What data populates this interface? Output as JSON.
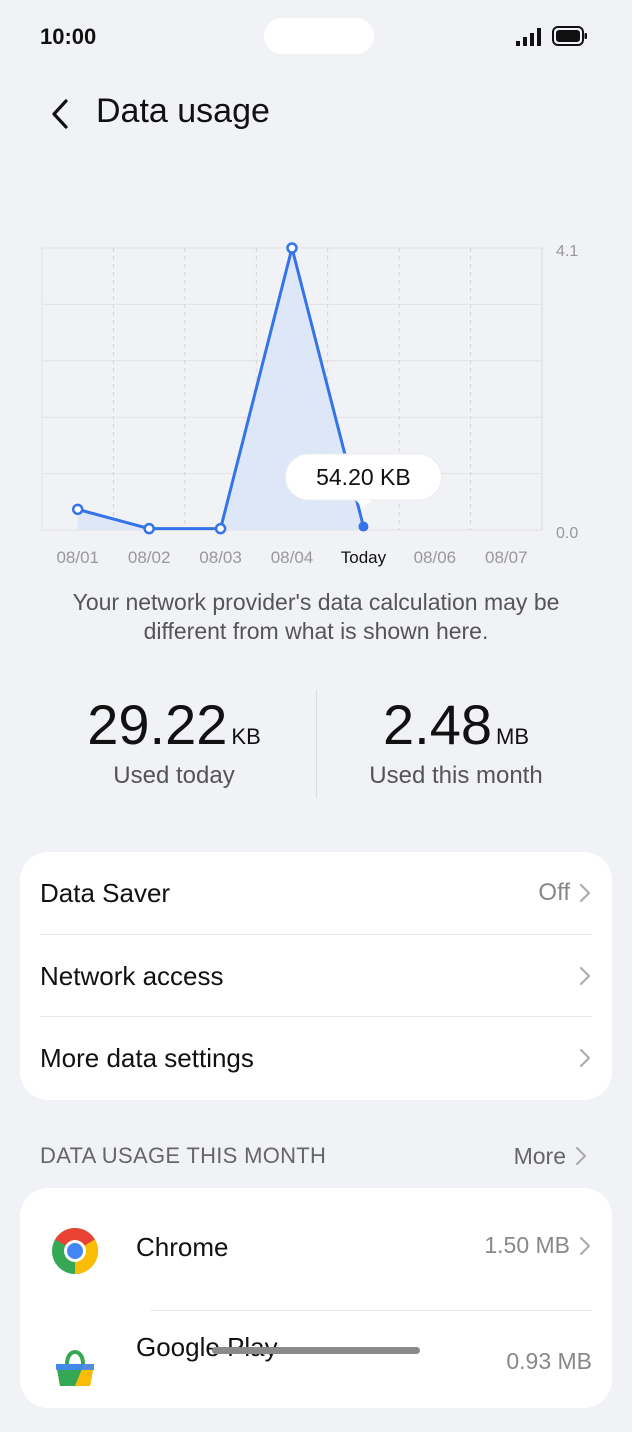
{
  "status_bar": {
    "time": "10:00"
  },
  "header": {
    "title": "Data usage"
  },
  "chart_data": {
    "type": "area",
    "categories": [
      "08/01",
      "08/02",
      "08/03",
      "08/04",
      "Today",
      "08/06",
      "08/07"
    ],
    "values": [
      0.3,
      0.02,
      0.02,
      4.1,
      0.05
    ],
    "ylim": [
      0.0,
      4.1
    ],
    "y_ticks": [
      "4.1",
      "0.0"
    ],
    "highlight_index": 4,
    "tooltip": "54.20 KB",
    "line_color": "#3574e8",
    "fill_color": "#dbe5f8"
  },
  "disclaimer": "Your network provider's data calculation may be different from what is shown here.",
  "stats": {
    "today": {
      "value": "29.22",
      "unit": "KB",
      "label": "Used today"
    },
    "month": {
      "value": "2.48",
      "unit": "MB",
      "label": "Used this month"
    }
  },
  "settings": [
    {
      "label": "Data Saver",
      "value": "Off"
    },
    {
      "label": "Network access",
      "value": ""
    },
    {
      "label": "More data settings",
      "value": ""
    }
  ],
  "section": {
    "title": "DATA USAGE THIS MONTH",
    "more_label": "More"
  },
  "apps": [
    {
      "name": "Chrome",
      "size": "1.50 MB",
      "icon": "chrome-icon"
    },
    {
      "name": "Google Play",
      "size": "0.93 MB",
      "icon": "google-play-icon"
    }
  ]
}
